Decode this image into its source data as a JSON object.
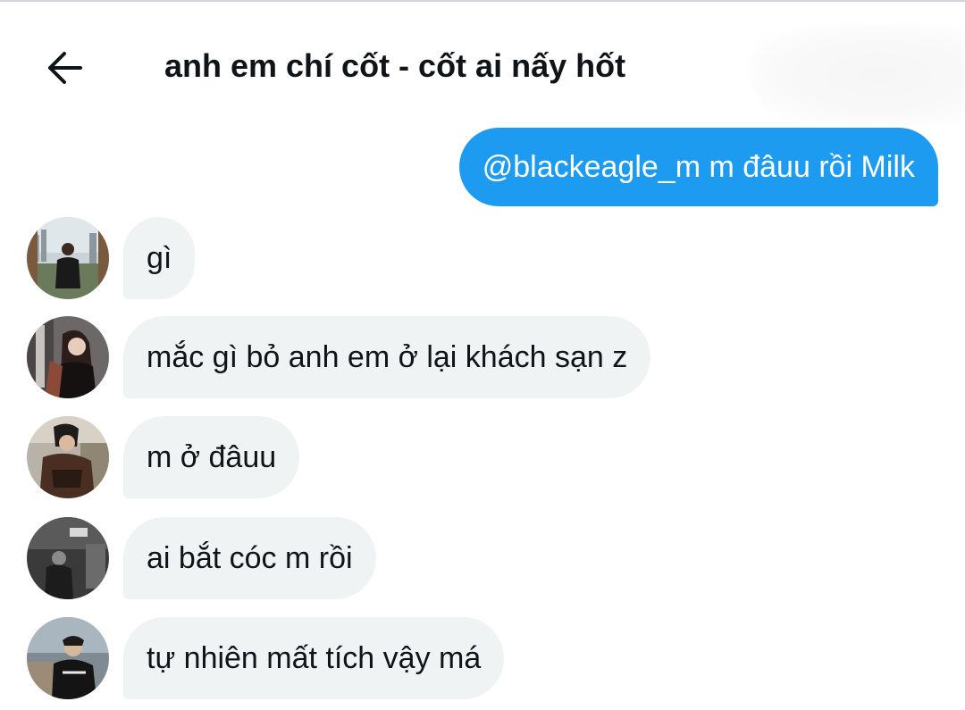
{
  "header": {
    "title": "anh em chí cốt - cốt ai nấy hốt",
    "back_icon": "arrow-left-icon"
  },
  "colors": {
    "sent_bubble": "#1d9bf0",
    "received_bubble": "#eff3f4",
    "text": "#0f1419"
  },
  "sent_messages": [
    {
      "text": "@blackeagle_m m đâuu rồi Milk"
    }
  ],
  "received_messages": [
    {
      "text": "gì",
      "avatar": "avatar-user-1"
    },
    {
      "text": "mắc gì bỏ anh em ở lại khách sạn z",
      "avatar": "avatar-user-2"
    },
    {
      "text": "m ở đâuu",
      "avatar": "avatar-user-3"
    },
    {
      "text": "ai bắt cóc m rồi",
      "avatar": "avatar-user-4"
    },
    {
      "text": "tự nhiên mất tích vậy má",
      "avatar": "avatar-user-5"
    }
  ]
}
